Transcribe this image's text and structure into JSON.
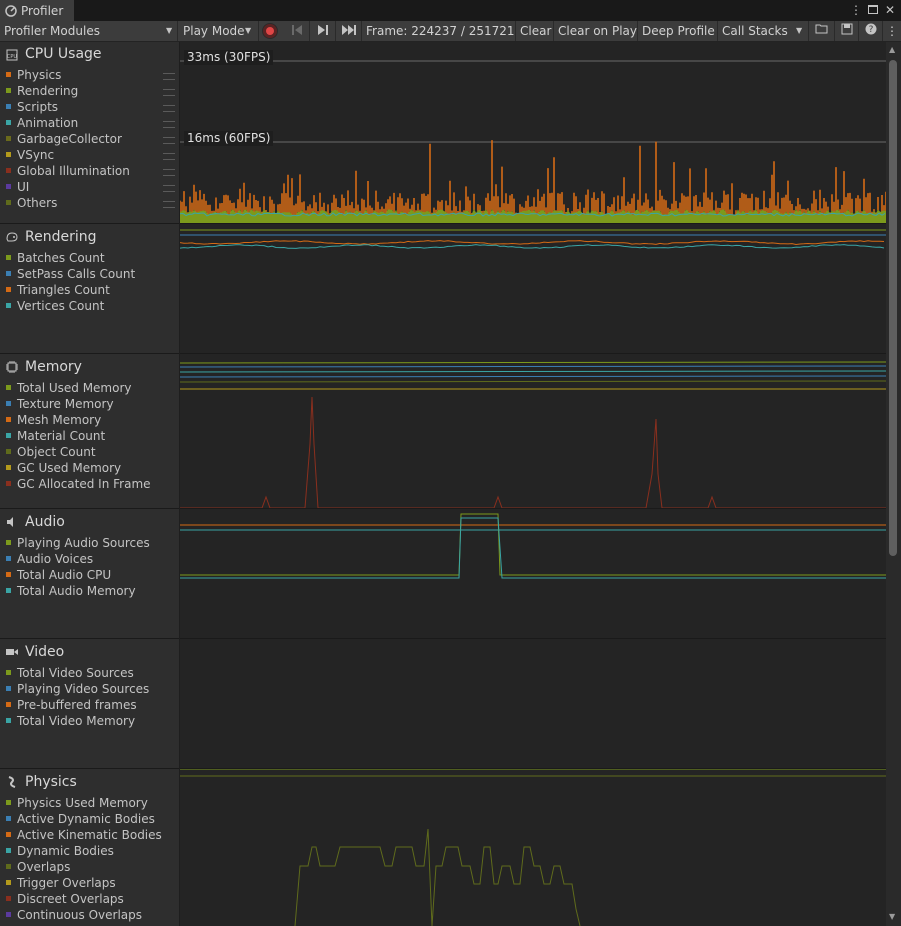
{
  "window": {
    "tab_title": "Profiler",
    "menu_icon": "kebab-icon",
    "maximize_icon": "maximize-icon",
    "close_icon": "close-icon"
  },
  "toolbar": {
    "modules_dropdown": "Profiler Modules",
    "target_dropdown": "Play Mode",
    "frame": "Frame: 224237 / 251721",
    "clear": "Clear",
    "clear_on_play": "Clear on Play",
    "deep_profile": "Deep Profile",
    "call_stacks": "Call Stacks"
  },
  "colors": {
    "olive": "#7c9a1c",
    "blue": "#3b7fb3",
    "orange": "#d46a15",
    "cyan": "#3aa5a5",
    "dark_olive": "#5f6b1c",
    "yellow": "#b39a1c",
    "red": "#8a2f1e",
    "purple": "#5b3a9e"
  },
  "modules": [
    {
      "title": "CPU Usage",
      "icon": "cpu-icon",
      "series": [
        {
          "label": "Physics",
          "color": "#d46a15"
        },
        {
          "label": "Rendering",
          "color": "#7c9a1c"
        },
        {
          "label": "Scripts",
          "color": "#3b7fb3"
        },
        {
          "label": "Animation",
          "color": "#3aa5a5"
        },
        {
          "label": "GarbageCollector",
          "color": "#6a6a1c"
        },
        {
          "label": "VSync",
          "color": "#b39a1c"
        },
        {
          "label": "Global Illumination",
          "color": "#8a2f1e"
        },
        {
          "label": "UI",
          "color": "#5b3a9e"
        },
        {
          "label": "Others",
          "color": "#5f6b1c"
        }
      ]
    },
    {
      "title": "Rendering",
      "icon": "rendering-icon",
      "series": [
        {
          "label": "Batches Count",
          "color": "#7c9a1c"
        },
        {
          "label": "SetPass Calls Count",
          "color": "#3b7fb3"
        },
        {
          "label": "Triangles Count",
          "color": "#d46a15"
        },
        {
          "label": "Vertices Count",
          "color": "#3aa5a5"
        }
      ]
    },
    {
      "title": "Memory",
      "icon": "memory-chip-icon",
      "series": [
        {
          "label": "Total Used Memory",
          "color": "#7c9a1c"
        },
        {
          "label": "Texture Memory",
          "color": "#3b7fb3"
        },
        {
          "label": "Mesh Memory",
          "color": "#d46a15"
        },
        {
          "label": "Material Count",
          "color": "#3aa5a5"
        },
        {
          "label": "Object Count",
          "color": "#5f6b1c"
        },
        {
          "label": "GC Used Memory",
          "color": "#b39a1c"
        },
        {
          "label": "GC Allocated In Frame",
          "color": "#8a2f1e"
        }
      ]
    },
    {
      "title": "Audio",
      "icon": "speaker-icon",
      "series": [
        {
          "label": "Playing Audio Sources",
          "color": "#7c9a1c"
        },
        {
          "label": "Audio Voices",
          "color": "#3b7fb3"
        },
        {
          "label": "Total Audio CPU",
          "color": "#d46a15"
        },
        {
          "label": "Total Audio Memory",
          "color": "#3aa5a5"
        }
      ]
    },
    {
      "title": "Video",
      "icon": "video-camera-icon",
      "series": [
        {
          "label": "Total Video Sources",
          "color": "#7c9a1c"
        },
        {
          "label": "Playing Video Sources",
          "color": "#3b7fb3"
        },
        {
          "label": "Pre-buffered frames",
          "color": "#d46a15"
        },
        {
          "label": "Total Video Memory",
          "color": "#3aa5a5"
        }
      ]
    },
    {
      "title": "Physics",
      "icon": "physics-icon",
      "series": [
        {
          "label": "Physics Used Memory",
          "color": "#7c9a1c"
        },
        {
          "label": "Active Dynamic Bodies",
          "color": "#3b7fb3"
        },
        {
          "label": "Active Kinematic Bodies",
          "color": "#d46a15"
        },
        {
          "label": "Dynamic Bodies",
          "color": "#3aa5a5"
        },
        {
          "label": "Overlaps",
          "color": "#5f6b1c"
        },
        {
          "label": "Trigger Overlaps",
          "color": "#b39a1c"
        },
        {
          "label": "Discreet Overlaps",
          "color": "#8a2f1e"
        },
        {
          "label": "Continuous Overlaps",
          "color": "#5b3a9e"
        }
      ]
    }
  ],
  "cpu_graph": {
    "marker_30fps": "33ms (30FPS)",
    "marker_60fps": "16ms (60FPS)"
  }
}
